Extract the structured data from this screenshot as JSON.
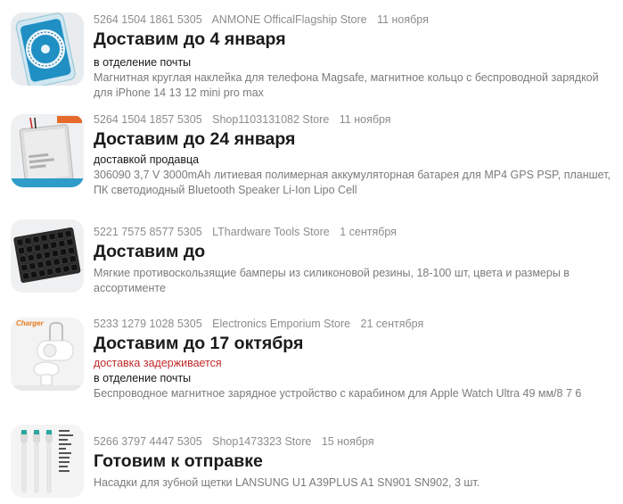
{
  "orders": [
    {
      "order_number": "5264 1504 1861 5305",
      "store": "ANMONE OfficalFlagship Store",
      "date": "11 ноября",
      "status": "Доставим до 4 января",
      "delivery_note": "",
      "delivery_method": "в отделение почты",
      "description": "Магнитная круглая наклейка для телефона Magsafe, магнитное кольцо с беспроводной зарядкой для iPhone 14 13 12 mini pro max",
      "image_icon": "magsafe-sticker-icon"
    },
    {
      "order_number": "5264 1504 1857 5305",
      "store": "Shop1103131082 Store",
      "date": "11 ноября",
      "status": "Доставим до 24 января",
      "delivery_note": "",
      "delivery_method": "доставкой продавца",
      "description": "306090 3,7 V 3000mAh литиевая полимерная аккумуляторная батарея для MP4 GPS PSP, планшет, ПК светодиодный Bluetooth Speaker Li-Ion Lipo Cell",
      "image_icon": "battery-icon"
    },
    {
      "order_number": "5221 7575 8577 5305",
      "store": "LThardware Tools Store",
      "date": "1 сентября",
      "status": "Доставим до",
      "delivery_note": "",
      "delivery_method": "",
      "description": "Мягкие противоскользящие бамперы из силиконовой резины, 18-100 шт, цвета и размеры в ассортименте",
      "image_icon": "rubber-bumpers-icon"
    },
    {
      "order_number": "5233 1279 1028 5305",
      "store": "Electronics Emporium Store",
      "date": "21 сентября",
      "status": "Доставим до 17 октября",
      "delivery_note": "доставка задерживается",
      "delivery_method": "в отделение почты",
      "description": "Беспроводное магнитное зарядное устройство с карабином для Apple Watch Ultra 49 мм/8 7 6",
      "image_icon": "watch-charger-icon",
      "image_caption": "Charger"
    },
    {
      "order_number": "5266 3797 4447 5305",
      "store": "Shop1473323 Store",
      "date": "15 ноября",
      "status": "Готовим к отправке",
      "delivery_note": "",
      "delivery_method": "",
      "description": "Насадки для зубной щетки LANSUNG U1 A39PLUS A1 SN901 SN902, 3 шт.",
      "image_icon": "toothbrush-heads-icon"
    }
  ],
  "colors": {
    "meta": "#8c8c8c",
    "warning": "#c12a2a",
    "thumb_bg": "#f1f1f2"
  }
}
